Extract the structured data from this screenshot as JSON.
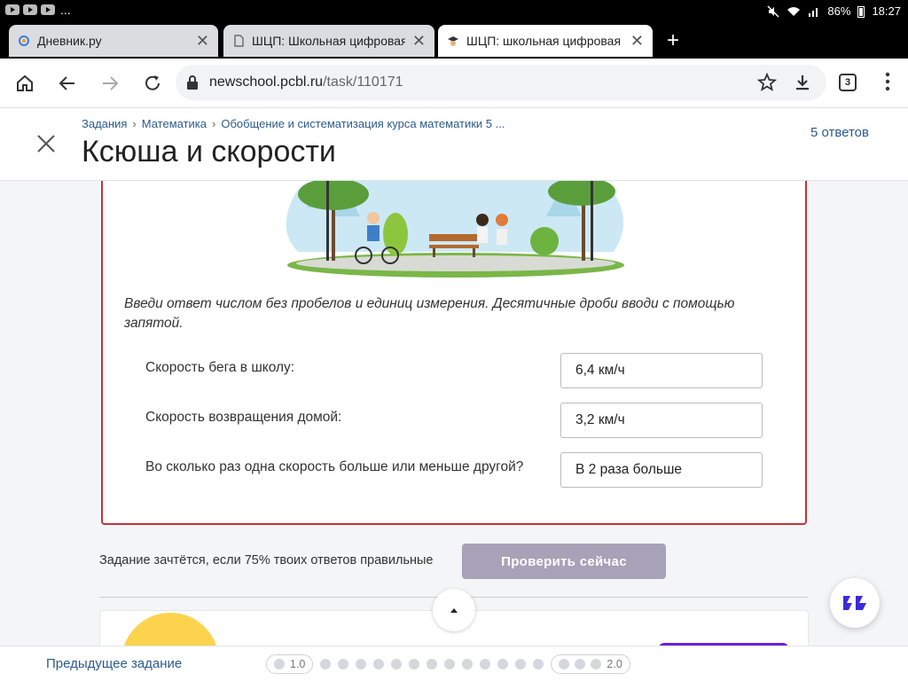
{
  "status_bar": {
    "dots": "...",
    "battery": "86%",
    "time": "18:27"
  },
  "tabs": [
    {
      "title": "Дневник.ру",
      "active": false
    },
    {
      "title": "ШЦП: Школьная цифровая",
      "active": false
    },
    {
      "title": "ШЦП: школьная цифровая",
      "active": true
    }
  ],
  "address_bar": {
    "domain": "newschool.pcbl.ru",
    "path": "/task/110171",
    "tab_count": "3"
  },
  "breadcrumb": [
    "Задания",
    "Математика",
    "Обобщение и систематизация курса математики 5 ..."
  ],
  "page_title": "Ксюша и скорости",
  "answers_count": "5 ответов",
  "task": {
    "instruction": "Введи ответ числом без пробелов и единиц измерения. Десятичные дроби вводи с помощью запятой.",
    "questions": [
      {
        "label": "Скорость бега в школу:",
        "value": "6,4 км/ч"
      },
      {
        "label": "Скорость возвращения домой:",
        "value": "3,2 км/ч"
      },
      {
        "label": "Во сколько раз одна скорость больше или меньше другой?",
        "value": "В 2 раза больше"
      }
    ]
  },
  "check": {
    "hint": "Задание зачтётся, если 75% твоих ответов правильные",
    "button": "Проверить сейчас"
  },
  "footer": {
    "prev_task": "Предыдущее задание",
    "level_start": "1.0",
    "level_end": "2.0"
  },
  "colors": {
    "card_border": "#c8313a",
    "check_button": "#a7a2b8",
    "link": "#2d5a8c",
    "accent_purple": "#6b21d8"
  }
}
